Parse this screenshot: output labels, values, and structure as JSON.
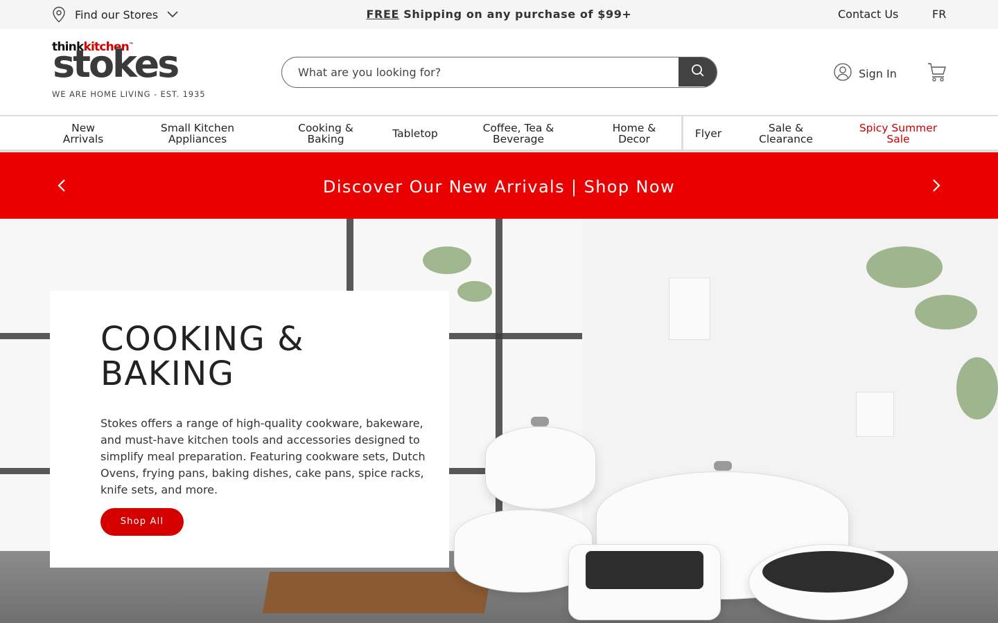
{
  "utility": {
    "store_label": "Find our Stores",
    "promo_free": "FREE",
    "promo_rest": " Shipping on any purchase of $99+",
    "contact": "Contact Us",
    "lang": "FR"
  },
  "logo": {
    "think": "think",
    "kitchen": "kitchen",
    "brand": "stokes",
    "tagline": "WE ARE HOME LIVING - EST. 1935"
  },
  "search": {
    "placeholder": "What are you looking for?",
    "value": ""
  },
  "account": {
    "signin": "Sign In"
  },
  "nav": {
    "items": [
      {
        "label": "New\nArrivals"
      },
      {
        "label": "Small Kitchen\nAppliances"
      },
      {
        "label": "Cooking &\nBaking"
      },
      {
        "label": "Tabletop"
      },
      {
        "label": "Coffee, Tea &\nBeverage"
      },
      {
        "label": "Home &\nDecor"
      },
      {
        "label": "Flyer"
      },
      {
        "label": "Sale &\nClearance"
      },
      {
        "label": "Spicy Summer\nSale"
      }
    ]
  },
  "banner": {
    "message": "Discover Our New Arrivals | Shop Now"
  },
  "hero": {
    "title": "COOKING &\nBAKING",
    "description": "Stokes offers a range of high-quality cookware, bakeware, and must-have kitchen tools and accessories designed to simplify meal preparation. Featuring cookware sets, Dutch Ovens, frying pans, baking dishes, cake pans, spice racks, knife sets, and more.",
    "cta": "Shop All"
  },
  "colors": {
    "brand_red": "#ea0000",
    "button_red": "#d40000",
    "sale_text": "#cc0000",
    "search_button": "#424242"
  },
  "icons": [
    "location-pin-icon",
    "chevron-down-icon",
    "search-icon",
    "user-icon",
    "cart-icon",
    "chevron-left-icon",
    "chevron-right-icon"
  ]
}
